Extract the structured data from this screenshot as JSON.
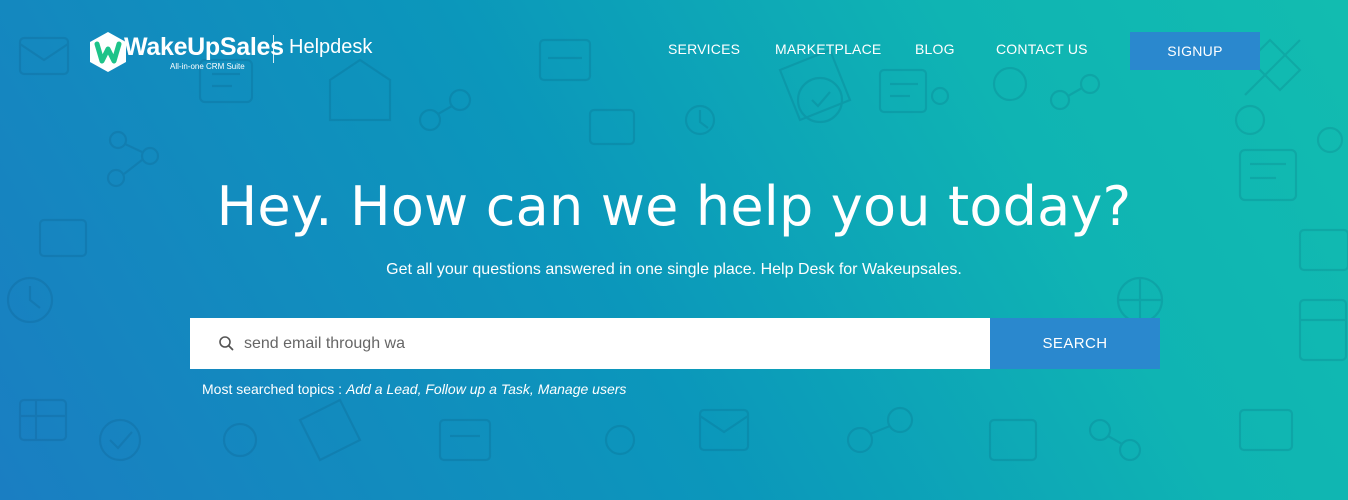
{
  "brand": {
    "name": "WakeUpSales",
    "tagline": "All-in-one CRM Suite",
    "product": "Helpdesk",
    "logo_color": "#1dc389"
  },
  "nav": {
    "items": [
      "SERVICES",
      "MARKETPLACE",
      "BLOG",
      "CONTACT US"
    ],
    "signup_label": "SIGNUP"
  },
  "hero": {
    "title": "Hey. How can we help you today?",
    "subtitle": "Get all your questions answered in one single place. Help Desk for Wakeupsales."
  },
  "search": {
    "value": "send email through wa",
    "button_label": "SEARCH",
    "icon": "search-icon"
  },
  "topics": {
    "label": "Most searched topics :",
    "items": [
      "Add a Lead,",
      "Follow up a Task,",
      "Manage users"
    ]
  },
  "colors": {
    "gradient_start": "#1a7ec2",
    "gradient_end": "#12bcb0",
    "button": "#2a88ce",
    "text": "#ffffff"
  }
}
